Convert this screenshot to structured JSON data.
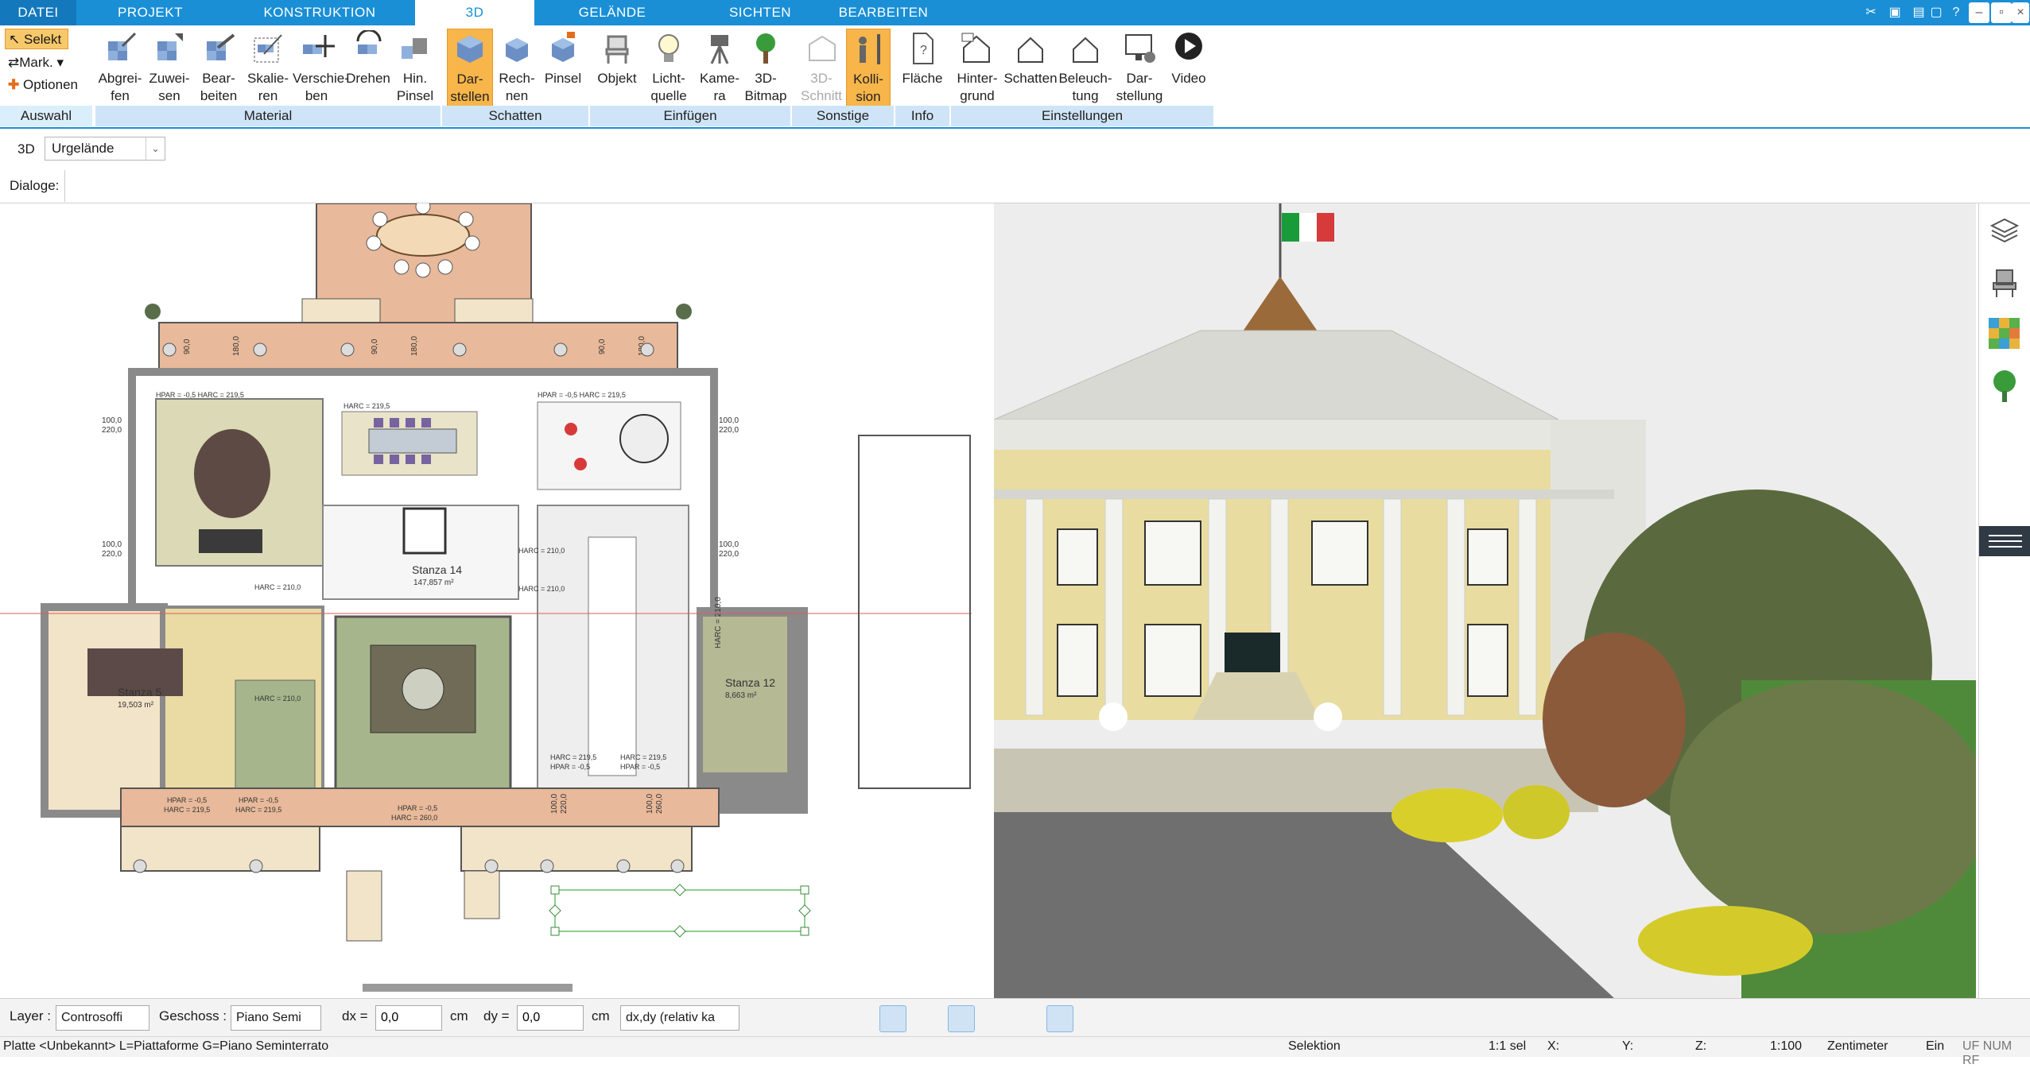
{
  "ribbon_tabs": [
    {
      "label": "DATEI"
    },
    {
      "label": "PROJEKT"
    },
    {
      "label": "KONSTRUKTION"
    },
    {
      "label": "3D"
    },
    {
      "label": "GELÄNDE"
    },
    {
      "label": "SICHTEN"
    },
    {
      "label": "BEARBEITEN"
    }
  ],
  "active_tab": "3D",
  "auswahl": {
    "select_label": "Selekt",
    "mark_label": "Mark.",
    "options_label": "Optionen",
    "group_label": "Auswahl"
  },
  "ribbon_buttons": [
    {
      "label": "Abgrei-\nfen"
    },
    {
      "label": "Zuwei-\nsen"
    },
    {
      "label": "Bear-\nbeiten"
    },
    {
      "label": "Skalie-\nren"
    },
    {
      "label": "Verschie-\nben"
    },
    {
      "label": "Drehen"
    },
    {
      "label": "Hin.\nPinsel"
    },
    {
      "label": "Dar-\nstellen"
    },
    {
      "label": "Rech-\nnen"
    },
    {
      "label": "Pinsel"
    },
    {
      "label": "Objekt"
    },
    {
      "label": "Licht-\nquelle"
    },
    {
      "label": "Kame-\nra"
    },
    {
      "label": "3D-\nBitmap"
    },
    {
      "label": "3D-\nSchnitt"
    },
    {
      "label": "Kolli-\nsion"
    },
    {
      "label": "Fläche"
    },
    {
      "label": "Hinter-\ngrund"
    },
    {
      "label": "Schatten"
    },
    {
      "label": "Beleuch-\ntung"
    },
    {
      "label": "Dar-\nstellung"
    },
    {
      "label": "Video"
    }
  ],
  "ribbon_groups": [
    {
      "label": "Material"
    },
    {
      "label": "Schatten"
    },
    {
      "label": "Einfügen"
    },
    {
      "label": "Sonstige"
    },
    {
      "label": "Info"
    },
    {
      "label": "Einstellungen"
    }
  ],
  "view_row": {
    "mode_label": "3D",
    "terrain_value": "Urgelände",
    "dialog_label": "Dialoge:"
  },
  "plan": {
    "rooms": [
      {
        "name": "Stanza 14",
        "area": "147,857 m²"
      },
      {
        "name": "Stanza 5",
        "area": "19,503 m²"
      },
      {
        "name": "Stanza 12",
        "area": "8,663 m²"
      }
    ],
    "dims": {
      "d1": "90,0",
      "d2": "180,0",
      "d3": "100,0",
      "d4": "220,0",
      "d5": "210,0",
      "d6": "260,0",
      "harc210": "HARC = 210,0",
      "harc2195": "HARC = 219,5",
      "harc260": "HARC = 260,0",
      "hpar": "HPAR = -0,5",
      "hpar_harc": "HPAR = -0,5 HARC = 219,5"
    },
    "colors": {
      "terracotta": "#e8b99a",
      "wall": "#8a8a8a",
      "green_room": "#a7b58c",
      "yellow_room": "#e9dba3",
      "beige": "#f2e4c8"
    }
  },
  "propbar": {
    "layer_label": "Layer :",
    "layer_value": "Controsoffi",
    "floor_label": "Geschoss :",
    "floor_value": "Piano Semi",
    "dx_label": "dx =",
    "dx_value": "0,0",
    "dx_unit": "cm",
    "dy_label": "dy =",
    "dy_value": "0,0",
    "dy_unit": "cm",
    "mode_value": "dx,dy (relativ ka"
  },
  "statusbar": {
    "left": "Platte <Unbekannt> L=Piattaforme G=Piano Seminterrato",
    "mode": "Selektion",
    "sel": "1:1 sel",
    "x": "X:",
    "y": "Y:",
    "z": "Z:",
    "scale": "1:100",
    "unit": "Zentimeter",
    "ein": "Ein",
    "flags": "UF NUM RF"
  }
}
